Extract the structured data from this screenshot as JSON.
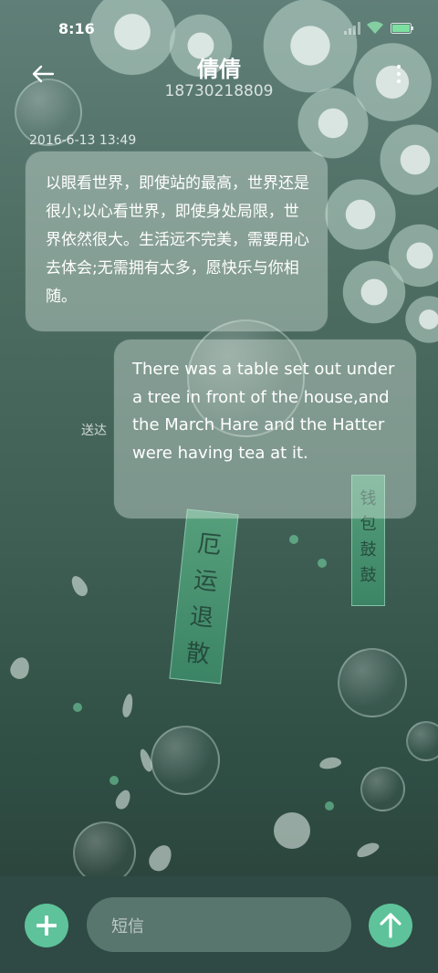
{
  "status_bar": {
    "time": "8:16"
  },
  "header": {
    "title": "倩倩",
    "subtitle": "18730218809"
  },
  "conversation": {
    "timestamp": "2016-6-13 13:49",
    "messages": [
      {
        "direction": "incoming",
        "text": "以眼看世界，即使站的最高，世界还是很小;以心看世界，即使身处局限，世界依然很大。生活远不完美，需要用心去体会;无需拥有太多，愿快乐与你相随。"
      },
      {
        "direction": "outgoing",
        "text": "There was a table set out under a tree in front of the house,and the March Hare and the Hatter were having tea at it.",
        "status": "送达"
      }
    ]
  },
  "composer": {
    "placeholder": "短信"
  },
  "background_art": {
    "tag_left": [
      "厄",
      "运",
      "退",
      "散"
    ],
    "tag_right": [
      "钱",
      "包",
      "鼓",
      "鼓"
    ]
  },
  "colors": {
    "accent": "#5ec39a",
    "bottom_bar": "#2f4a44"
  },
  "icons": [
    "back-arrow-icon",
    "more-vertical-icon",
    "plus-icon",
    "send-arrow-icon",
    "signal-icon",
    "wifi-icon",
    "battery-icon"
  ]
}
